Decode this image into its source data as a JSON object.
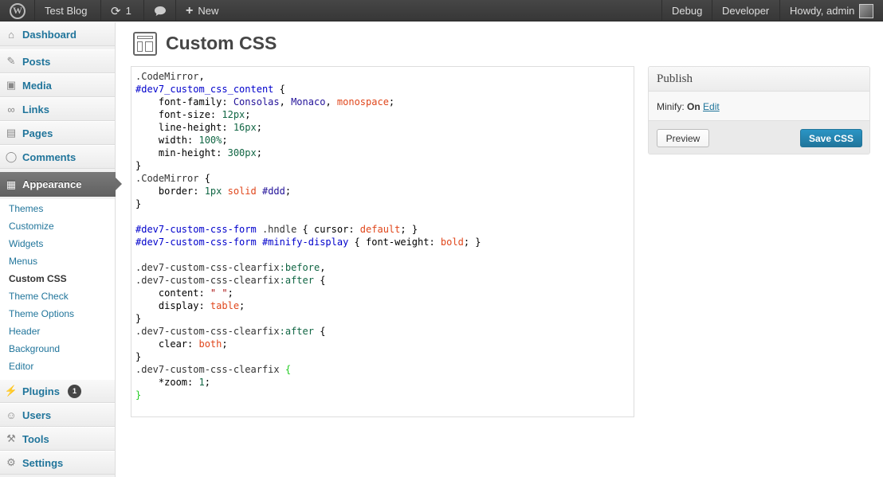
{
  "adminbar": {
    "site_name": "Test Blog",
    "updates_count": "1",
    "new_label": "New",
    "debug_label": "Debug",
    "developer_label": "Developer",
    "howdy_label": "Howdy, admin"
  },
  "sidebar": {
    "dashboard": "Dashboard",
    "posts": "Posts",
    "media": "Media",
    "links": "Links",
    "pages": "Pages",
    "comments": "Comments",
    "appearance": "Appearance",
    "submenu": [
      "Themes",
      "Customize",
      "Widgets",
      "Menus",
      "Custom CSS",
      "Theme Check",
      "Theme Options",
      "Header",
      "Background",
      "Editor"
    ],
    "plugins": "Plugins",
    "plugins_badge": "1",
    "users": "Users",
    "tools": "Tools",
    "settings": "Settings"
  },
  "page": {
    "title": "Custom CSS"
  },
  "editor": {
    "lines": [
      ".CodeMirror,",
      "#dev7_custom_css_content {",
      "    font-family: Consolas, Monaco, monospace;",
      "    font-size: 12px;",
      "    line-height: 16px;",
      "    width: 100%;",
      "    min-height: 300px;",
      "}",
      ".CodeMirror {",
      "    border: 1px solid #ddd;",
      "}",
      "",
      "#dev7-custom-css-form .hndle { cursor: default; }",
      "#dev7-custom-css-form #minify-display { font-weight: bold; }",
      "",
      ".dev7-custom-css-clearfix:before,",
      ".dev7-custom-css-clearfix:after {",
      "    content: \" \";",
      "    display: table;",
      "}",
      ".dev7-custom-css-clearfix:after {",
      "    clear: both;",
      "}",
      ".dev7-custom-css-clearfix {",
      "    *zoom: 1;",
      "}"
    ]
  },
  "publish": {
    "title": "Publish",
    "minify_label": "Minify:",
    "minify_value": "On",
    "edit_link": "Edit",
    "preview_button": "Preview",
    "save_button": "Save CSS"
  },
  "colors": {
    "link": "#21759b",
    "primary_button": "#21759b",
    "adminbar_bg": "#464646"
  }
}
